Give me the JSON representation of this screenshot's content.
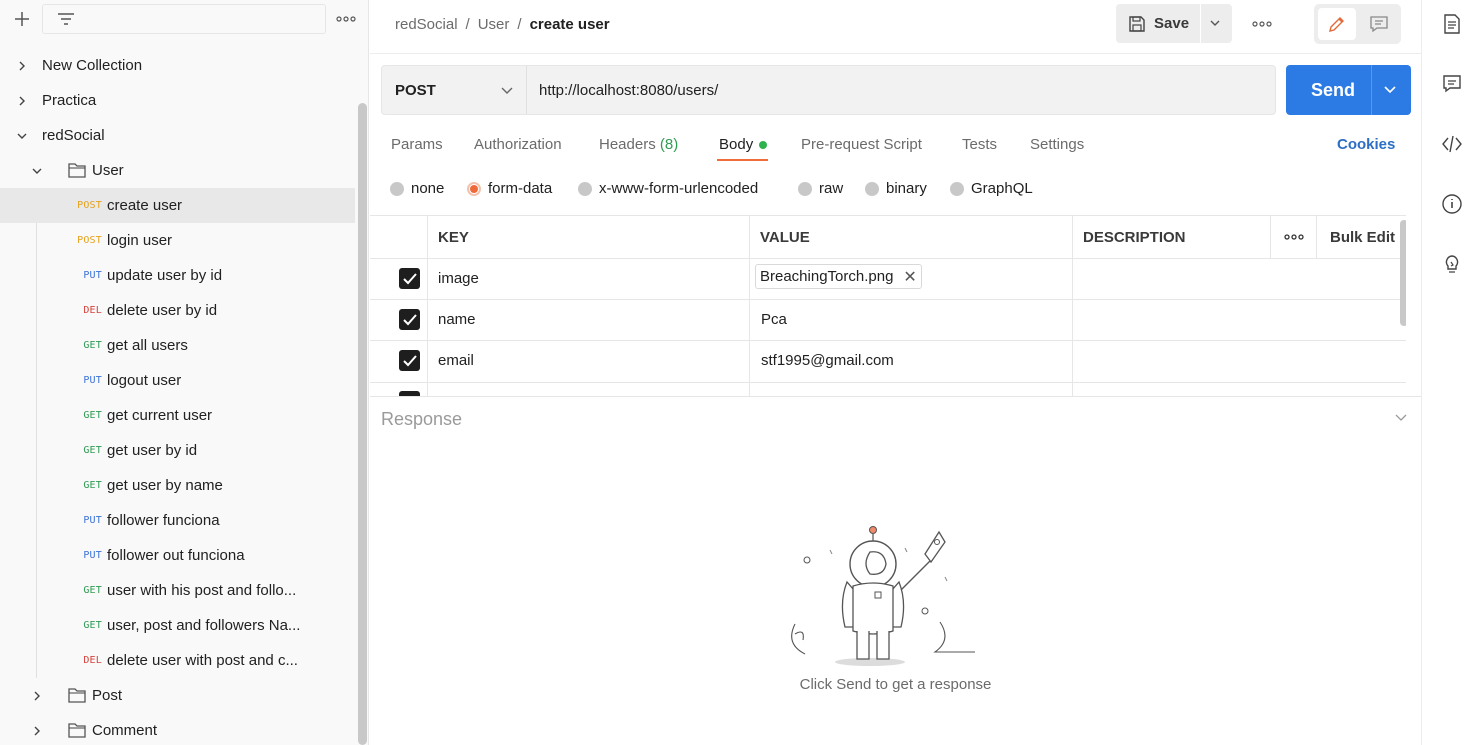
{
  "sidebar": {
    "tree": [
      {
        "type": "collection",
        "label": "New Collection",
        "expanded": false
      },
      {
        "type": "collection",
        "label": "Practica",
        "expanded": false
      },
      {
        "type": "collection",
        "label": "redSocial",
        "expanded": true
      },
      {
        "type": "folder",
        "label": "User",
        "expanded": true
      },
      {
        "type": "request",
        "method": "POST",
        "label": "create user",
        "selected": true
      },
      {
        "type": "request",
        "method": "POST",
        "label": "login user"
      },
      {
        "type": "request",
        "method": "PUT",
        "label": "update user by id"
      },
      {
        "type": "request",
        "method": "DEL",
        "label": "delete user by id"
      },
      {
        "type": "request",
        "method": "GET",
        "label": "get all users"
      },
      {
        "type": "request",
        "method": "PUT",
        "label": "logout user"
      },
      {
        "type": "request",
        "method": "GET",
        "label": "get current user"
      },
      {
        "type": "request",
        "method": "GET",
        "label": "get user by id"
      },
      {
        "type": "request",
        "method": "GET",
        "label": "get user by name"
      },
      {
        "type": "request",
        "method": "PUT",
        "label": "follower funciona"
      },
      {
        "type": "request",
        "method": "PUT",
        "label": "follower out funciona"
      },
      {
        "type": "request",
        "method": "GET",
        "label": "user with his post and follo..."
      },
      {
        "type": "request",
        "method": "GET",
        "label": "user, post and followers Na..."
      },
      {
        "type": "request",
        "method": "DEL",
        "label": "delete user with post and c..."
      },
      {
        "type": "folder",
        "label": "Post",
        "expanded": false
      },
      {
        "type": "folder",
        "label": "Comment",
        "expanded": false
      }
    ]
  },
  "header": {
    "breadcrumb": [
      "redSocial",
      "User",
      "create user"
    ],
    "save_label": "Save"
  },
  "request": {
    "method": "POST",
    "url": "http://localhost:8080/users/",
    "send_label": "Send"
  },
  "tabs": {
    "params": "Params",
    "authorization": "Authorization",
    "headers": "Headers",
    "headers_count": "(8)",
    "body": "Body",
    "prerequest": "Pre-request Script",
    "tests": "Tests",
    "settings": "Settings",
    "cookies": "Cookies"
  },
  "body_types": [
    "none",
    "form-data",
    "x-www-form-urlencoded",
    "raw",
    "binary",
    "GraphQL"
  ],
  "body_type_selected": "form-data",
  "table": {
    "headers": {
      "key": "KEY",
      "value": "VALUE",
      "description": "DESCRIPTION",
      "bulk_edit": "Bulk Edit"
    },
    "rows": [
      {
        "key": "image",
        "value": "BreachingTorch.png",
        "is_file": true,
        "checked": true
      },
      {
        "key": "name",
        "value": "Pca",
        "checked": true
      },
      {
        "key": "email",
        "value": "stf1995@gmail.com",
        "checked": true
      }
    ]
  },
  "response": {
    "title": "Response",
    "hint": "Click Send to get a response"
  },
  "colors": {
    "accent": "#f26b3a",
    "send": "#2c7be5",
    "post": "#e5a21b",
    "put": "#3b73d6",
    "delete": "#d6423a",
    "get": "#2e9c52"
  }
}
